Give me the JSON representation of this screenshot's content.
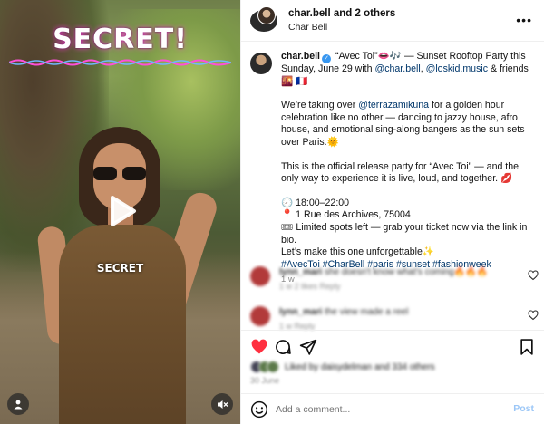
{
  "media": {
    "overlay_title": "SECRET!",
    "overlay_sub": "SECRET",
    "icons": [
      "user-tag-icon",
      "muted-speaker-icon",
      "play-icon"
    ]
  },
  "header": {
    "username": "char.bell",
    "and_others": " and 2 others",
    "subtitle": "Char Bell",
    "more": "•••"
  },
  "caption": {
    "username": "char.bell",
    "verified": "✓",
    "line1_a": " “Avec Toi”👄🎶 — Sunset Rooftop Party this Sunday, June 29 with ",
    "mention1": "@char.bell",
    "sep": ", ",
    "mention2": "@loskid.music",
    "line1_b": " & friends 🌇 🇫🇷",
    "p2_a": "We’re taking over ",
    "mention3": "@terrazamikuna",
    "p2_b": " for a golden hour celebration like no other — dancing to jazzy house, afro house, and emotional sing-along bangers as the sun sets over Paris.🌞",
    "p3": "This is the official release party for “Avec Toi” — and the only way to experience it is live, loud, and together. 💋",
    "time_line": "🕗 18:00–22:00",
    "address_line": "📍 1 Rue des Archives, 75004",
    "spots_line": "🎟 Limited spots left — grab your ticket now via the link in bio.",
    "closing": "Let’s make this one unforgettable✨",
    "hashtags": "#AvecToi #CharBell #paris #sunset #fashionweek",
    "age": "1 w"
  },
  "comments": [
    {
      "user": "lynn_mari",
      "text": "she doesn't know what's coming🔥🔥🔥",
      "meta": "1 w   2 likes   Reply"
    },
    {
      "user": "lynn_mari",
      "text": "the view made a reel",
      "meta": "1 w   Reply"
    }
  ],
  "likes": {
    "text": "Liked by daisydelman and 334 others",
    "date": "30 June"
  },
  "add_comment": {
    "placeholder": "Add a comment...",
    "post_label": "Post"
  },
  "colors": {
    "like_red": "#ff3040",
    "link_blue": "#00376b",
    "post_blue": "#9cc7f7",
    "verified_blue": "#3897f0"
  }
}
